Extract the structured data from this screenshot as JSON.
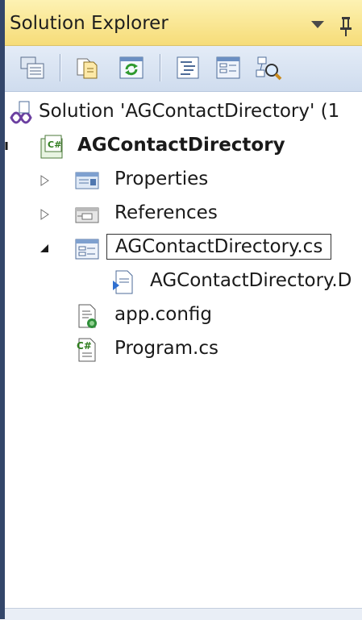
{
  "panel": {
    "title": "Solution Explorer"
  },
  "toolbar": {
    "buttons": [
      {
        "icon": "properties-window-icon"
      },
      {
        "icon": "show-all-files-icon"
      },
      {
        "icon": "refresh-icon"
      },
      {
        "icon": "view-code-icon"
      },
      {
        "icon": "view-designer-icon"
      },
      {
        "icon": "class-diagram-icon"
      }
    ]
  },
  "tree": {
    "solution": {
      "label": "Solution 'AGContactDirectory' (1"
    },
    "project": {
      "label": "AGContactDirectory"
    },
    "items": [
      {
        "label": "Properties",
        "expander": "collapsed"
      },
      {
        "label": "References",
        "expander": "collapsed"
      },
      {
        "label": "AGContactDirectory.cs",
        "expander": "expanded",
        "selected": true
      },
      {
        "label": "AGContactDirectory.D"
      },
      {
        "label": "app.config"
      },
      {
        "label": "Program.cs"
      }
    ]
  },
  "colors": {
    "titlebar": "#f6dc78",
    "toolbar": "#d6e1f1",
    "frame": "#33466a"
  }
}
